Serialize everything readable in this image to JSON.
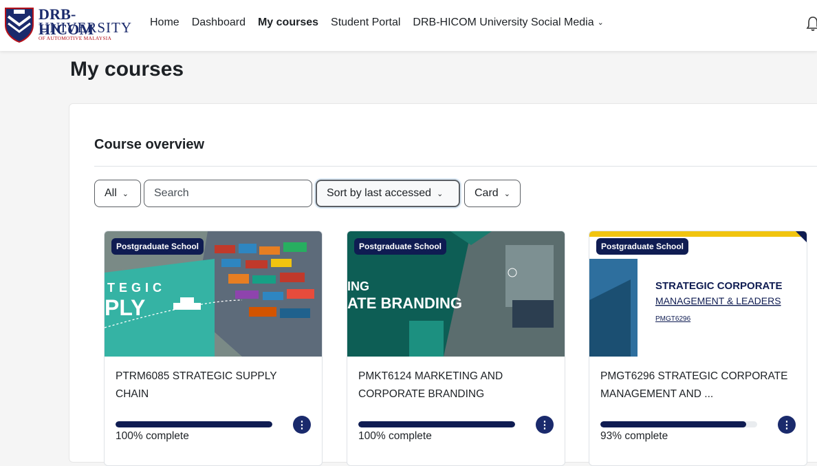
{
  "brand": {
    "line1": "DRB-HICOM",
    "line2": "UNIVERSITY",
    "line3": "OF AUTOMOTIVE MALAYSIA"
  },
  "nav": {
    "items": [
      {
        "label": "Home"
      },
      {
        "label": "Dashboard"
      },
      {
        "label": "My courses"
      },
      {
        "label": "Student Portal"
      },
      {
        "label": "DRB-HICOM University Social Media"
      }
    ]
  },
  "page": {
    "title": "My courses"
  },
  "overview": {
    "title": "Course overview",
    "filter_label": "All",
    "search_placeholder": "Search",
    "sort_label": "Sort by last accessed",
    "view_label": "Card"
  },
  "courses": [
    {
      "badge": "Postgraduate School",
      "banner_line1": "TEGIC",
      "banner_line2": "PLY",
      "name": "PTRM6085 STRATEGIC SUPPLY CHAIN",
      "progress": 100,
      "progress_text": "100% complete"
    },
    {
      "badge": "Postgraduate School",
      "banner_line1": "ING",
      "banner_line2": "ATE BRANDING",
      "name": "PMKT6124 MARKETING AND CORPORATE BRANDING",
      "progress": 100,
      "progress_text": "100% complete"
    },
    {
      "badge": "Postgraduate School",
      "banner_line1": "STRATEGIC CORPORATE",
      "banner_line2": "MANAGEMENT & LEADERS",
      "banner_line3": "PMGT6296",
      "name": "PMGT6296 STRATEGIC CORPORATE MANAGEMENT AND ...",
      "progress": 93,
      "progress_text": "93% complete"
    }
  ],
  "colors": {
    "brand_navy": "#0f1c52",
    "brand_red": "#b5121b",
    "progress_track": "#e9ecef"
  },
  "icons": {
    "menu": "three-dots-vertical-icon",
    "bell": "bell-icon",
    "chevron": "chevron-down-icon"
  }
}
